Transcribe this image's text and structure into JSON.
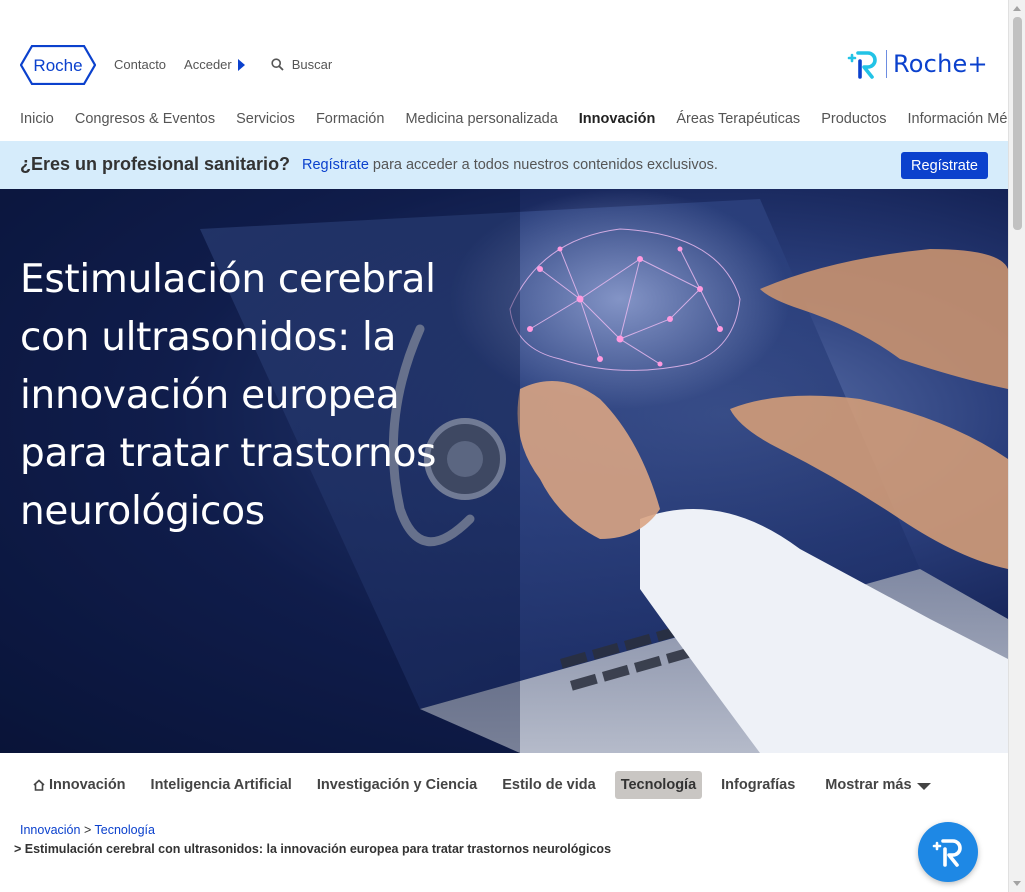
{
  "header": {
    "logo_text": "Roche",
    "top_links": {
      "contact": "Contacto",
      "login": "Acceder",
      "search_placeholder": "Buscar"
    },
    "roche_plus": "Roche+"
  },
  "main_nav": {
    "items": [
      {
        "label": "Inicio"
      },
      {
        "label": "Congresos & Eventos"
      },
      {
        "label": "Servicios"
      },
      {
        "label": "Formación"
      },
      {
        "label": "Medicina personalizada"
      },
      {
        "label": "Innovación"
      },
      {
        "label": "Áreas Terapéuticas"
      },
      {
        "label": "Productos"
      },
      {
        "label": "Información Médica"
      }
    ],
    "active": "Innovación"
  },
  "pro_banner": {
    "question": "¿Eres un profesional sanitario?",
    "link_text": "Regístrate",
    "text": " para acceder a todos nuestros contenidos exclusivos.",
    "button_label": "Regístrate"
  },
  "hero": {
    "title": "Estimulación cerebral con ultrasonidos: la innovación europea para tratar trastornos neurológicos"
  },
  "sub_nav": {
    "items": [
      {
        "label": "Innovación",
        "icon": "home-icon"
      },
      {
        "label": "Inteligencia Artificial"
      },
      {
        "label": "Investigación y Ciencia"
      },
      {
        "label": "Estilo de vida"
      },
      {
        "label": "Tecnología"
      },
      {
        "label": "Infografías"
      }
    ],
    "active": "Tecnología",
    "more_label": "Mostrar más"
  },
  "breadcrumb": {
    "items": [
      "Innovación",
      "Tecnología"
    ],
    "separator": ">",
    "current": "> Estimulación cerebral con ultrasonidos: la innovación europea para tratar trastornos neurológicos"
  },
  "colors": {
    "brand_blue": "#0b41cd",
    "banner_bg": "#d6ecfb",
    "chat_blue": "#1e88e5",
    "roche_plus_cyan": "#22c3e6"
  }
}
